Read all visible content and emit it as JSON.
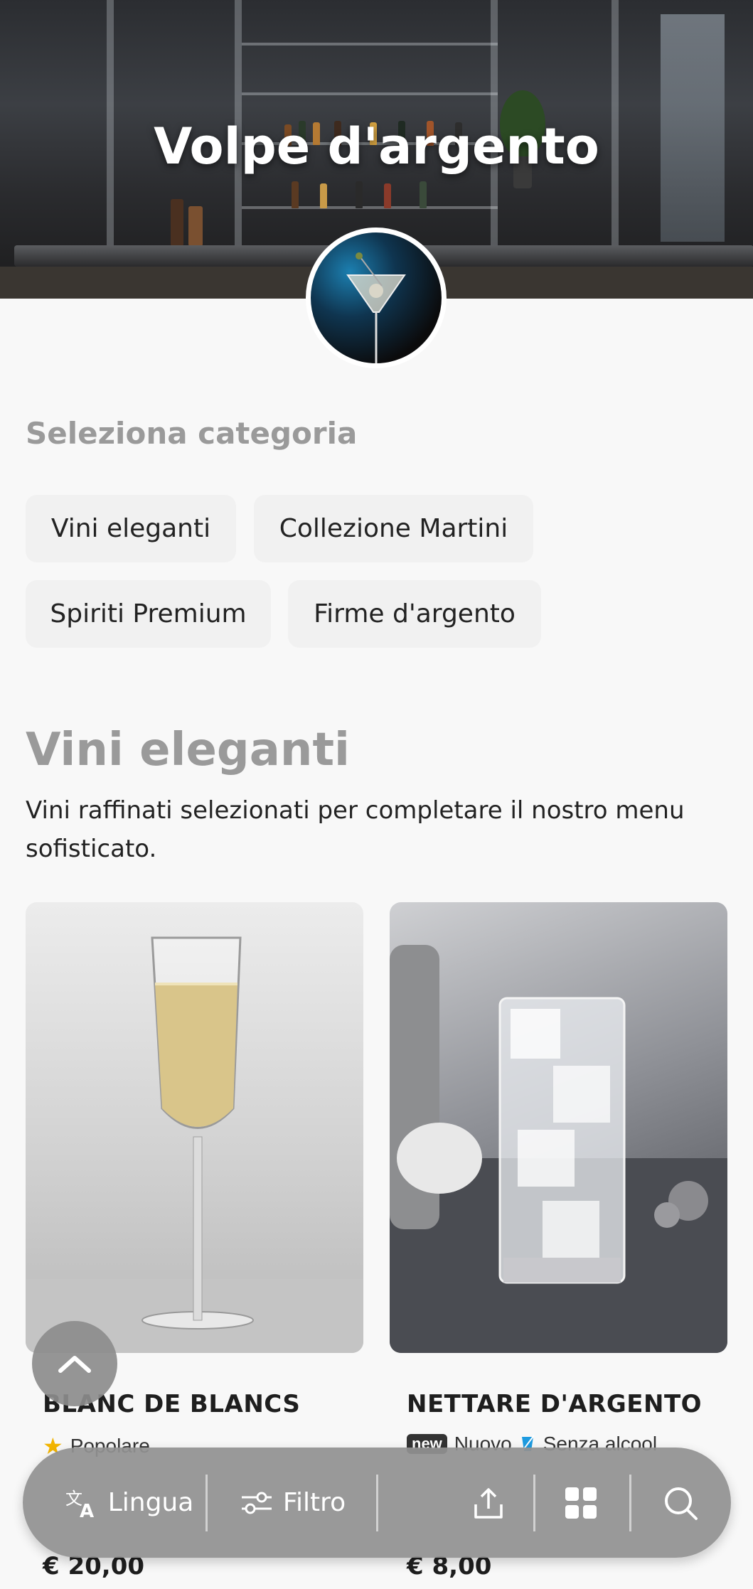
{
  "header": {
    "title": "Volpe d'argento"
  },
  "categories": {
    "label": "Seleziona categoria",
    "chips": [
      "Vini eleganti",
      "Collezione Martini",
      "Spiriti Premium",
      "Firme d'argento"
    ]
  },
  "section": {
    "title": "Vini eleganti",
    "description": "Vini raffinati selezionati per completare il nostro menu sofisticato."
  },
  "items": [
    {
      "name": "BLANC DE BLANCS",
      "tags": [
        "Popolare"
      ],
      "price": "€ 20,00"
    },
    {
      "name": "NETTARE D'ARGENTO",
      "badge": "new",
      "tags": [
        "Nuovo",
        "Senza alcool"
      ],
      "price": "€ 8,00"
    }
  ],
  "bottom_bar": {
    "language": "Lingua",
    "filter": "Filtro"
  },
  "icons": [
    "translate-icon",
    "filter-icon",
    "share-icon",
    "grid-icon",
    "search-icon",
    "chevron-up-icon",
    "star-icon",
    "alcohol-free-icon"
  ]
}
